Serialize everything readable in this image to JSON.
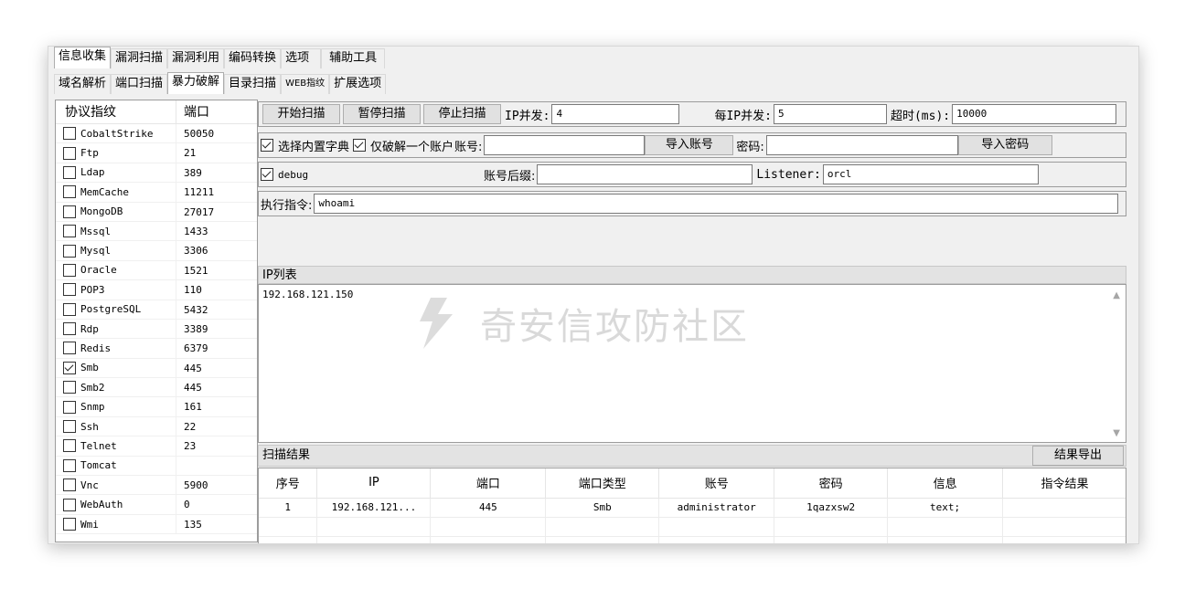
{
  "tabs_top": [
    {
      "label": "信息收集",
      "active": true
    },
    {
      "label": "漏洞扫描",
      "active": false
    },
    {
      "label": "漏洞利用",
      "active": false
    },
    {
      "label": "编码转换",
      "active": false
    },
    {
      "label": "选项",
      "active": false
    },
    {
      "label": "辅助工具",
      "active": false
    }
  ],
  "tabs_sub": [
    {
      "label": "域名解析",
      "active": false
    },
    {
      "label": "端口扫描",
      "active": false
    },
    {
      "label": "暴力破解",
      "active": true
    },
    {
      "label": "目录扫描",
      "active": false
    },
    {
      "label": "WEB指纹",
      "active": false
    },
    {
      "label": "扩展选项",
      "active": false
    }
  ],
  "protocol_list": {
    "header_protocol": "协议指纹",
    "header_port": "端口",
    "items": [
      {
        "name": "CobaltStrike",
        "port": "50050",
        "checked": false
      },
      {
        "name": "Ftp",
        "port": "21",
        "checked": false
      },
      {
        "name": "Ldap",
        "port": "389",
        "checked": false
      },
      {
        "name": "MemCache",
        "port": "11211",
        "checked": false
      },
      {
        "name": "MongoDB",
        "port": "27017",
        "checked": false
      },
      {
        "name": "Mssql",
        "port": "1433",
        "checked": false
      },
      {
        "name": "Mysql",
        "port": "3306",
        "checked": false
      },
      {
        "name": "Oracle",
        "port": "1521",
        "checked": false
      },
      {
        "name": "POP3",
        "port": "110",
        "checked": false
      },
      {
        "name": "PostgreSQL",
        "port": "5432",
        "checked": false
      },
      {
        "name": "Rdp",
        "port": "3389",
        "checked": false
      },
      {
        "name": "Redis",
        "port": "6379",
        "checked": false
      },
      {
        "name": "Smb",
        "port": "445",
        "checked": true
      },
      {
        "name": "Smb2",
        "port": "445",
        "checked": false
      },
      {
        "name": "Snmp",
        "port": "161",
        "checked": false
      },
      {
        "name": "Ssh",
        "port": "22",
        "checked": false
      },
      {
        "name": "Telnet",
        "port": "23",
        "checked": false
      },
      {
        "name": "Tomcat",
        "port": "",
        "checked": false
      },
      {
        "name": "Vnc",
        "port": "5900",
        "checked": false
      },
      {
        "name": "WebAuth",
        "port": "0",
        "checked": false
      },
      {
        "name": "Wmi",
        "port": "135",
        "checked": false
      }
    ]
  },
  "controls": {
    "start_scan": "开始扫描",
    "pause_scan": "暂停扫描",
    "stop_scan": "停止扫描",
    "ip_concurrency_label": "IP并发:",
    "ip_concurrency_value": "4",
    "per_ip_concurrency_label": "每IP并发:",
    "per_ip_concurrency_value": "5",
    "timeout_label": "超时(ms):",
    "timeout_value": "10000",
    "builtin_dict_label": "选择内置字典",
    "builtin_dict_checked": true,
    "one_account_label": "仅破解一个账户",
    "one_account_checked": true,
    "account_label": "账号:",
    "account_value": "",
    "import_account": "导入账号",
    "password_label": "密码:",
    "password_value": "",
    "import_password": "导入密码",
    "debug_label": "debug",
    "debug_checked": true,
    "account_suffix_label": "账号后缀:",
    "account_suffix_value": "",
    "listener_label": "Listener:",
    "listener_value": "orcl",
    "exec_cmd_label": "执行指令:",
    "exec_cmd_value": "whoami"
  },
  "ip_list": {
    "title": "IP列表",
    "content": "192.168.121.150"
  },
  "watermark": "奇安信攻防社区",
  "results": {
    "title": "扫描结果",
    "export_button": "结果导出",
    "columns": [
      "序号",
      "IP",
      "端口",
      "端口类型",
      "账号",
      "密码",
      "信息",
      "指令结果"
    ],
    "rows": [
      [
        "1",
        "192.168.121...",
        "445",
        "Smb",
        "administrator",
        "1qazxsw2",
        "text;",
        ""
      ]
    ]
  }
}
